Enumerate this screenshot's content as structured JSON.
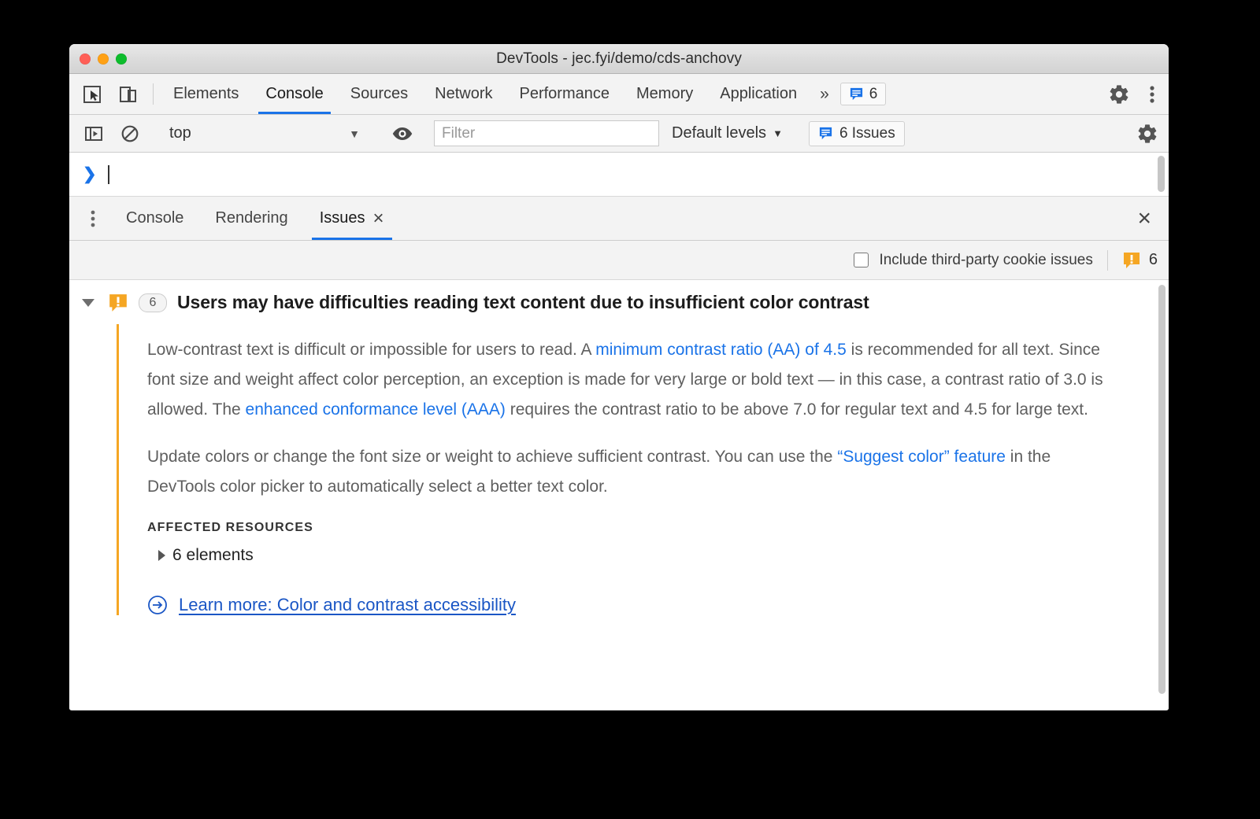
{
  "window": {
    "title": "DevTools - jec.fyi/demo/cds-anchovy",
    "traffic_lights": [
      "close",
      "minimize",
      "maximize"
    ]
  },
  "main_toolbar": {
    "inspect_icon": "inspect-cursor-icon",
    "device_icon": "device-toolbar-icon",
    "tabs": [
      {
        "label": "Elements",
        "active": false
      },
      {
        "label": "Console",
        "active": true
      },
      {
        "label": "Sources",
        "active": false
      },
      {
        "label": "Network",
        "active": false
      },
      {
        "label": "Performance",
        "active": false
      },
      {
        "label": "Memory",
        "active": false
      },
      {
        "label": "Application",
        "active": false
      }
    ],
    "more_tabs_label": "»",
    "issues_pill_count": "6",
    "settings_icon": "gear-icon",
    "more_icon": "kebab-menu-icon"
  },
  "console_toolbar": {
    "sidebar_icon": "console-sidebar-icon",
    "clear_icon": "clear-console-icon",
    "context": "top",
    "context_caret": "▼",
    "eye_icon": "live-expression-eye-icon",
    "filter_placeholder": "Filter",
    "filter_value": "",
    "levels_label": "Default levels",
    "levels_caret": "▼",
    "issues_button_label": "6 Issues",
    "settings_icon": "gear-icon"
  },
  "prompt": {
    "caret": "❯",
    "value": ""
  },
  "drawer": {
    "kebab_icon": "kebab-menu-icon",
    "tabs": [
      {
        "label": "Console",
        "active": false,
        "closable": false
      },
      {
        "label": "Rendering",
        "active": false,
        "closable": false
      },
      {
        "label": "Issues",
        "active": true,
        "closable": true
      }
    ],
    "tab_close_glyph": "×",
    "close_drawer_glyph": "×"
  },
  "issues_options": {
    "cookie_checkbox_label": "Include third-party cookie issues",
    "cookie_checkbox_checked": false,
    "warning_icon": "warning-issue-icon",
    "warning_count": "6"
  },
  "issue": {
    "expanded": true,
    "severity_icon": "warning-issue-icon",
    "count": "6",
    "title": "Users may have difficulties reading text content due to insufficient color contrast",
    "paragraph1": {
      "p1": "Low-contrast text is difficult or impossible for users to read. A ",
      "link1": "minimum contrast ratio (AA) of 4.5",
      "p2": " is recommended for all text. Since font size and weight affect color perception, an exception is made for very large or bold text — in this case, a contrast ratio of 3.0 is allowed. The ",
      "link2": "enhanced conformance level (AAA)",
      "p3": " requires the contrast ratio to be above 7.0 for regular text and 4.5 for large text."
    },
    "paragraph2": {
      "p1": "Update colors or change the font size or weight to achieve sufficient contrast. You can use the ",
      "link1": "“Suggest color” feature",
      "p2": " in the DevTools color picker to automatically select a better text color."
    },
    "affected_resources_label": "AFFECTED RESOURCES",
    "affected_resources_item": "6 elements",
    "learn_more_icon": "external-link-arrow-icon",
    "learn_more_label": "Learn more: Color and contrast accessibility",
    "accent_bar_color": "#f5a623"
  },
  "colors": {
    "accent_blue": "#1a73e8",
    "link_blue": "#1a56c5",
    "warning_orange": "#f5a623",
    "toolbar_bg": "#f3f3f3"
  }
}
